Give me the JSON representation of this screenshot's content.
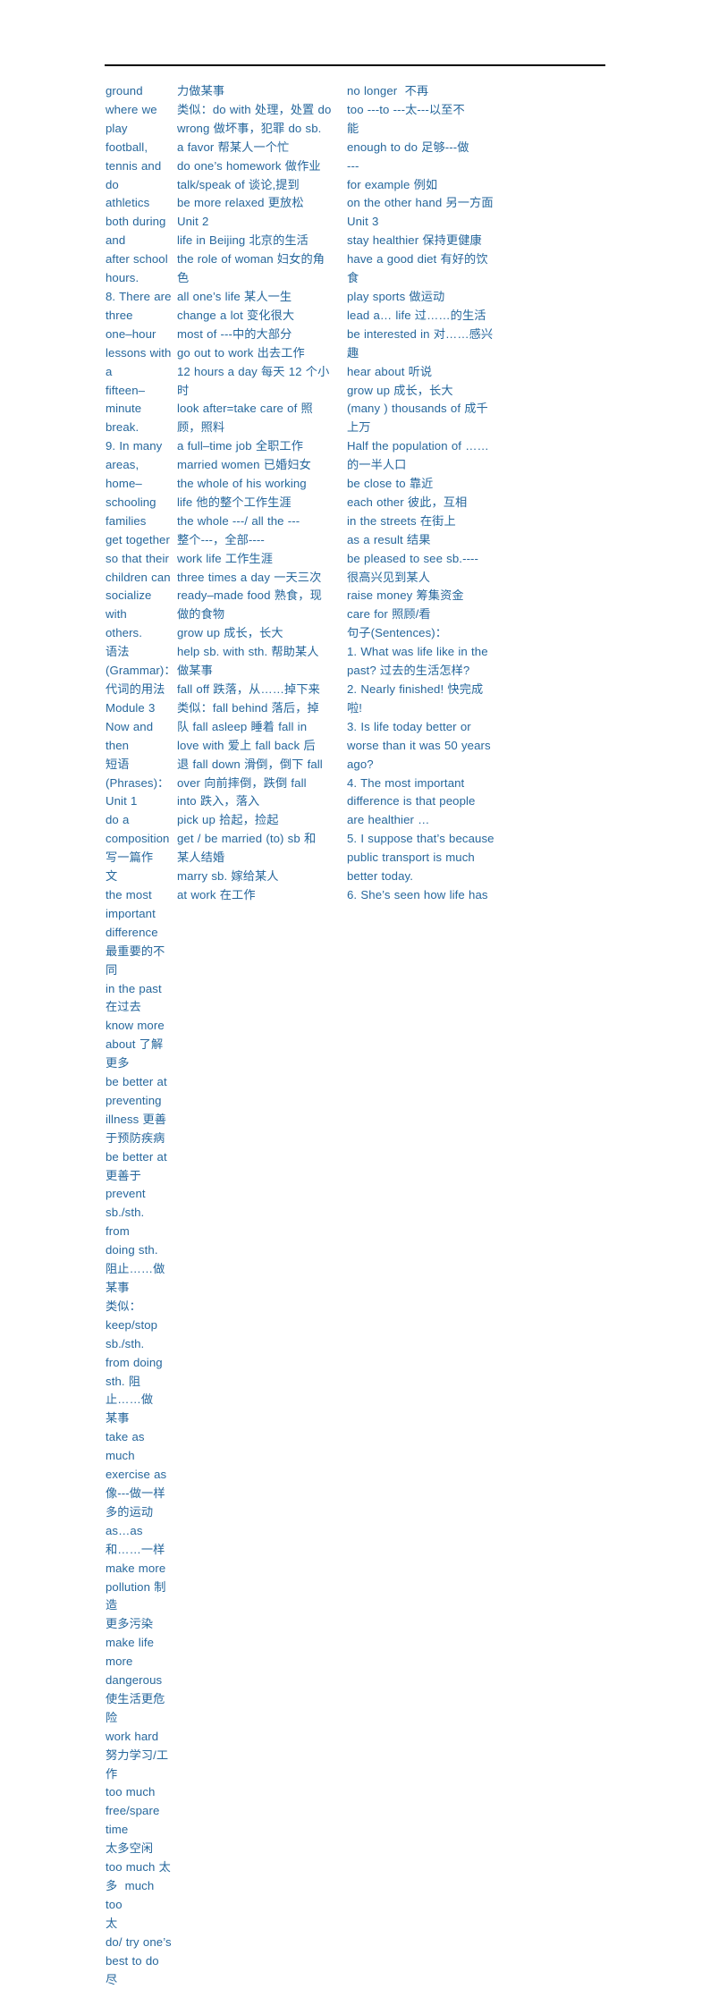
{
  "page": {
    "background_color": "#ffffff",
    "text_color": "#26679c",
    "rule_color": "#000000",
    "title": "Module 3 Now and then - Phrases and Sentences Study Notes"
  },
  "columns": [
    {
      "id": "column-1",
      "lines": [
        "ground where we play",
        "football, tennis and do",
        "athletics both during and",
        "after school hours.",
        "8. There are three",
        "one–hour lessons with a",
        "fifteen–minute break.",
        "9. In many areas,",
        "home–schooling families",
        "get together so that their",
        "children can socialize with",
        "others.",
        "语法(Grammar)：",
        "代词的用法",
        "Module 3 Now and then",
        "短语(Phrases)：",
        "Unit 1",
        "do a composition 写一篇作",
        "文",
        "the most important",
        "difference 最重要的不同",
        "in the past 在过去",
        "know more about 了解更多",
        "be better at preventing",
        "illness 更善于预防疾病",
        "be better at 更善于",
        "prevent sb./sth. from",
        "doing sth. 阻止……做某事",
        "类似：keep/stop sb./sth.",
        "from doing sth. 阻止……做",
        "某事",
        "take as much exercise as",
        "像---做一样多的运动",
        "as…as 和……一样",
        "make more pollution 制造",
        "更多污染",
        "make life more dangerous",
        "使生活更危险",
        "work hard 努力学习/工作",
        "too much free/spare time",
        "太多空闲",
        "too much 太多  much too",
        "太",
        "do/ try one’s best to do 尽"
      ]
    },
    {
      "id": "column-2",
      "lines": [
        "力做某事",
        "类似：do with 处理，处置 do",
        "wrong 做坏事，犯罪 do sb.",
        "a favor 帮某人一个忙",
        "do one’s homework 做作业",
        "talk/speak of 谈论,提到",
        "be more relaxed 更放松",
        "Unit 2",
        "life in Beijing 北京的生活",
        "the role of woman 妇女的角",
        "色",
        "all one’s life 某人一生",
        "change a lot 变化很大",
        "most of ---中的大部分",
        "go out to work 出去工作",
        "12 hours a day 每天 12 个小",
        "时",
        "look after=take care of 照",
        "顾，照料",
        "a full–time job 全职工作",
        "married women 已婚妇女",
        "the whole of his working",
        "life 他的整个工作生涯",
        "the whole ---/ all the ---",
        "整个---，全部----",
        "work life 工作生涯",
        "three times a day 一天三次",
        "ready–made food 熟食，现",
        "做的食物",
        "grow up 成长，长大",
        "help sb. with sth. 帮助某人",
        "做某事",
        "fall off 跌落，从……掉下来",
        "类似：fall behind 落后，掉",
        "队 fall asleep 睡着 fall in",
        "love with 爱上 fall back 后",
        "退 fall down 滑倒，倒下 fall",
        "over 向前摔倒，跌倒 fall",
        "into 跌入，落入",
        "pick up 拾起，捡起",
        "get / be married (to) sb 和",
        "某人结婚",
        "marry sb. 嫁给某人",
        "at work 在工作"
      ]
    },
    {
      "id": "column-3",
      "lines": [
        "no longer  不再",
        "too ---to ---太---以至不",
        "能",
        "enough to do 足够---做",
        "---",
        "for example 例如",
        "on the other hand 另一方面",
        "Unit 3",
        "stay healthier 保持更健康",
        "have a good diet 有好的饮",
        "食",
        "play sports 做运动",
        "lead a… life 过……的生活",
        "be interested in 对……感兴",
        "趣",
        "hear about 听说",
        "grow up 成长，长大",
        "(many ) thousands of 成千",
        "上万",
        "Half the population of ……",
        "的一半人口",
        "be close to 靠近",
        "each other 彼此，互相",
        "in the streets 在街上",
        "as a result 结果",
        "be pleased to see sb.----",
        "很高兴见到某人",
        "raise money 筹集资金",
        "care for 照顾/看",
        "句子(Sentences)：",
        "1. What was life like in the",
        "past? 过去的生活怎样?",
        "2. Nearly finished! 快完成",
        "啦!",
        "3. Is life today better or",
        "worse than it was 50 years",
        "ago?",
        "4. The most important",
        "difference is that people",
        "are healthier …",
        "5. I suppose that’s because",
        "public transport is much",
        "better today.",
        "6. She’s seen how life has"
      ]
    }
  ]
}
